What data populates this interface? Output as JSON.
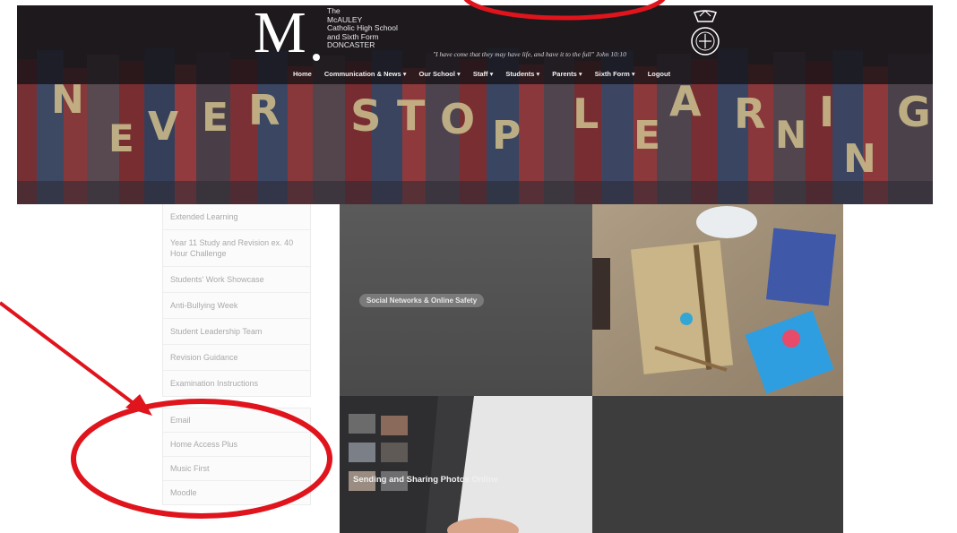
{
  "header": {
    "logo_letter": "M",
    "logo_lines": [
      "The",
      "McAULEY",
      "Catholic High School",
      "and Sixth Form",
      "DONCASTER"
    ],
    "motto": "\"I have come that they may have life, and have it to the full\" John 10:10",
    "banner_letters": [
      "N",
      "E",
      "V",
      "E",
      "R",
      "S",
      "T",
      "O",
      "P",
      "L",
      "E",
      "A",
      "R",
      "N",
      "I",
      "N",
      "G"
    ]
  },
  "nav": {
    "items": [
      "Home",
      "Communication & News ▾",
      "Our School ▾",
      "Staff ▾",
      "Students ▾",
      "Parents ▾",
      "Sixth Form ▾",
      "Logout"
    ]
  },
  "sidebar": {
    "panel1": [
      "Extended Learning",
      "Year 11 Study and Revision ex. 40 Hour Challenge",
      "Students' Work Showcase",
      "Anti-Bullying Week",
      "Student Leadership Team",
      "Revision Guidance",
      "Examination Instructions"
    ],
    "panel2": [
      "Email",
      "Home Access Plus",
      "Music First",
      "Moodle"
    ]
  },
  "tiles": {
    "social_label": "Social Networks & Online Safety",
    "photos_label": "Sending and Sharing Photos Online"
  },
  "colors": {
    "annotation_red": "#e0141c",
    "banner_dark": "#2a2528",
    "sidebar_text": "#a9a9a9"
  }
}
